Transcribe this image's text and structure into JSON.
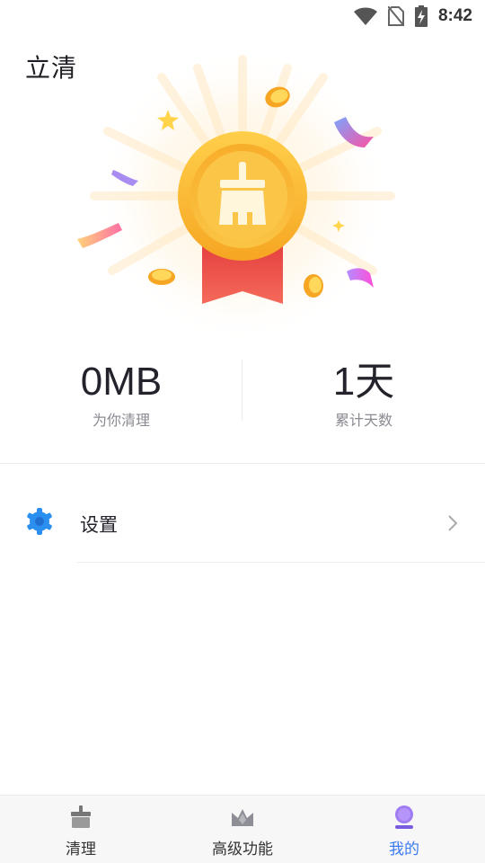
{
  "status_bar": {
    "time": "8:42",
    "icons": [
      "wifi-icon",
      "no-sim-icon",
      "battery-charging-icon"
    ]
  },
  "app": {
    "title": "立清"
  },
  "stats": {
    "cleaned": {
      "value": "0MB",
      "label": "为你清理"
    },
    "days": {
      "value": "1天",
      "label": "累计天数"
    }
  },
  "menu": {
    "settings_label": "设置",
    "settings_icon": "gear-icon"
  },
  "tabs": [
    {
      "label": "清理",
      "icon": "broom-icon",
      "active": false
    },
    {
      "label": "高级功能",
      "icon": "crown-icon",
      "active": false
    },
    {
      "label": "我的",
      "icon": "profile-icon",
      "active": true
    }
  ],
  "colors": {
    "accent": "#3c7af0",
    "medal_gold": "#f8b42a",
    "ribbon_red": "#ef4f4a",
    "settings_blue": "#2b8ff0"
  }
}
